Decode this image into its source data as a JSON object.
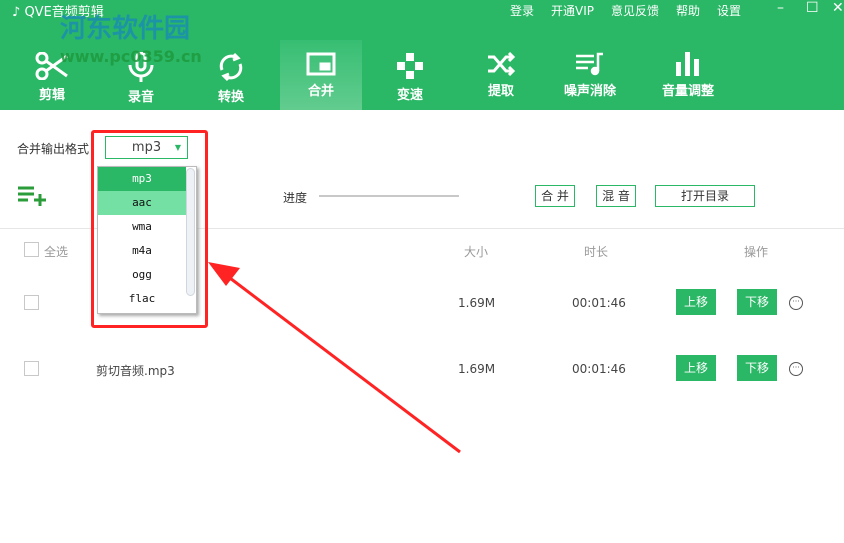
{
  "app": {
    "title": "QVE音频剪辑",
    "watermark": "河东软件园",
    "watermark_url": "www.pc0359.cn"
  },
  "topnav": [
    "登录",
    "开通VIP",
    "意见反馈",
    "帮助",
    "设置"
  ],
  "window": {
    "minimize": "–",
    "maximize": "☐",
    "close": "✕"
  },
  "tabs": [
    {
      "label": "剪辑",
      "icon": "scissors-icon"
    },
    {
      "label": "录音",
      "icon": "microphone-icon"
    },
    {
      "label": "转换",
      "icon": "refresh-icon"
    },
    {
      "label": "合并",
      "icon": "merge-icon",
      "active": true
    },
    {
      "label": "变速",
      "icon": "gamepad-icon"
    },
    {
      "label": "提取",
      "icon": "shuffle-icon"
    },
    {
      "label": "噪声消除",
      "icon": "music-list-icon"
    },
    {
      "label": "音量调整",
      "icon": "bar-chart-icon"
    }
  ],
  "format": {
    "label": "合并输出格式",
    "value": "mp3",
    "options": [
      "mp3",
      "aac",
      "wma",
      "m4a",
      "ogg",
      "flac"
    ]
  },
  "toolbar": {
    "progress_label": "进度",
    "progress": 0,
    "merge": "合 并",
    "mix": "混 音",
    "open_dir": "打开目录"
  },
  "table": {
    "select_all": "全选",
    "headers": {
      "size": "大小",
      "duration": "时长",
      "actions": "操作"
    },
    "rows": [
      {
        "name": "",
        "size": "1.69M",
        "duration": "00:01:46"
      },
      {
        "name": "剪切音频.mp3",
        "size": "1.69M",
        "duration": "00:01:46"
      }
    ],
    "up": "上移",
    "down": "下移",
    "more": "···"
  },
  "colors": {
    "brand": "#2ab766",
    "annotation": "#ff2323"
  }
}
